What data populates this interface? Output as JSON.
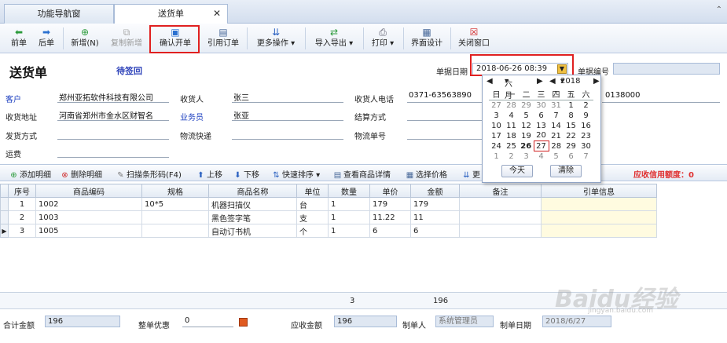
{
  "tabs": [
    {
      "label": "功能导航窗"
    },
    {
      "label": "送货单"
    }
  ],
  "toolbar": {
    "prev": "前单",
    "next": "后单",
    "new": "新增(N)",
    "copy_new": "复制新增",
    "confirm": "确认开单",
    "cite": "引用订单",
    "more": "更多操作",
    "import_export": "导入导出",
    "print": "打印",
    "ui_design": "界面设计",
    "close": "关闭窗口"
  },
  "header": {
    "title": "送货单",
    "status": "待签回",
    "date_label": "单据日期",
    "date_value": "2018-06-26 08:39",
    "docno_label": "单据编号"
  },
  "form": {
    "customer_label": "客户",
    "customer_value": "郑州亚拓软件科技有限公司",
    "receiver_label": "收货人",
    "receiver_value": "张三",
    "receiver_phone_label": "收货人电话",
    "receiver_phone_value": "0371-63563890",
    "phone_extra": "0138000",
    "address_label": "收货地址",
    "address_value": "河南省郑州市金水区财智名",
    "salesman_label": "业务员",
    "salesman_value": "张亚",
    "settle_label": "结算方式",
    "ship_label": "发货方式",
    "logistics_label": "物流快递",
    "logistics_no_label": "物流单号",
    "freight_label": "运费"
  },
  "grid_toolbar": {
    "add": "添加明细",
    "delete": "删除明细",
    "scan": "扫描条形码(F4)",
    "up": "上移",
    "down": "下移",
    "sort": "快速排序",
    "detail": "查看商品详情",
    "price": "选择价格",
    "more": "更",
    "credit": "应收信用额度：0"
  },
  "grid": {
    "columns": [
      "序号",
      "商品编码",
      "规格",
      "商品名称",
      "单位",
      "数量",
      "单价",
      "金额",
      "备注",
      "引单信息"
    ],
    "rows": [
      {
        "no": "1",
        "code": "1002",
        "spec": "10*5",
        "name": "机器扫描仪",
        "unit": "台",
        "qty": "1",
        "price": "179",
        "amount": "179"
      },
      {
        "no": "2",
        "code": "1003",
        "spec": "",
        "name": "黑色签字笔",
        "unit": "支",
        "qty": "1",
        "price": "11.22",
        "amount": "11"
      },
      {
        "no": "3",
        "code": "1005",
        "spec": "",
        "name": "自动订书机",
        "unit": "个",
        "qty": "1",
        "price": "6",
        "amount": "6"
      }
    ],
    "sum_qty": "3",
    "sum_amount": "196"
  },
  "footer": {
    "total_label": "合计金额",
    "total_value": "196",
    "discount_label": "整单优惠",
    "discount_value": "0",
    "receivable_label": "应收金额",
    "receivable_value": "196",
    "maker_label": "制单人",
    "maker_value": "系统管理员",
    "make_date_label": "制单日期",
    "make_date_value": "2018/6/27"
  },
  "calendar": {
    "month": "六月",
    "year": "2018",
    "weekdays": [
      "日",
      "一",
      "二",
      "三",
      "四",
      "五",
      "六"
    ],
    "weeks": [
      [
        "27",
        "28",
        "29",
        "30",
        "31",
        "1",
        "2"
      ],
      [
        "3",
        "4",
        "5",
        "6",
        "7",
        "8",
        "9"
      ],
      [
        "10",
        "11",
        "12",
        "13",
        "14",
        "15",
        "16"
      ],
      [
        "17",
        "18",
        "19",
        "20",
        "21",
        "22",
        "23"
      ],
      [
        "24",
        "25",
        "26",
        "27",
        "28",
        "29",
        "30"
      ],
      [
        "1",
        "2",
        "3",
        "4",
        "5",
        "6",
        "7"
      ]
    ],
    "today_btn": "今天",
    "clear_btn": "清除"
  },
  "watermark": {
    "text": "Baidu经验",
    "url": "jingyan.baidu.com"
  },
  "colors": {
    "accent_blue": "#1e40c0",
    "highlight_red": "#e02020",
    "ref_bg": "#fffbe0"
  }
}
